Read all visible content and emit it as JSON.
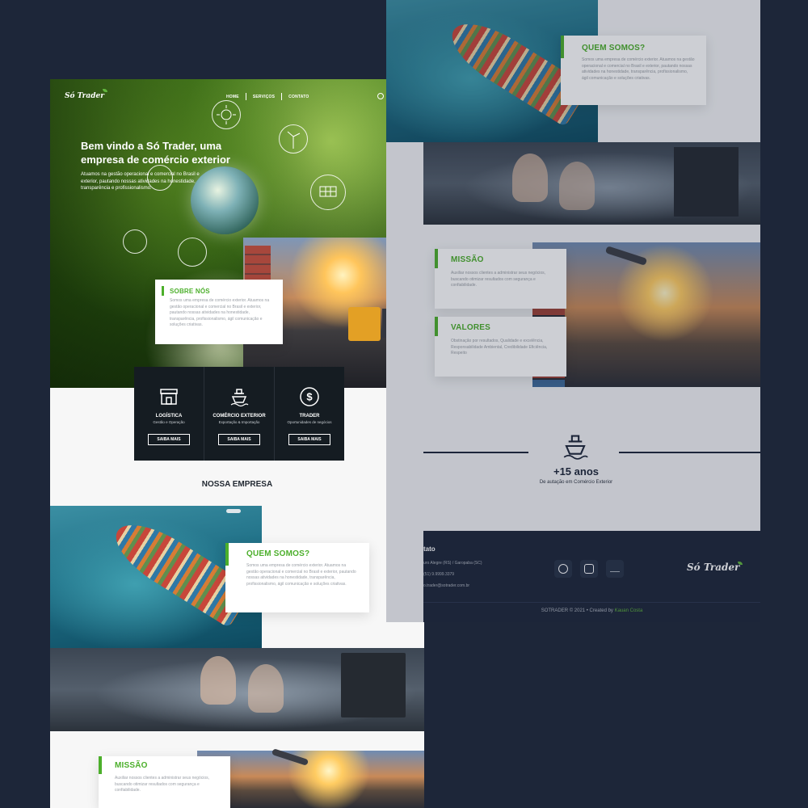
{
  "header": {
    "logo": "Só Trader",
    "nav": [
      "HOME",
      "SERVIÇOS",
      "CONTATO"
    ]
  },
  "hero": {
    "title": "Bem vindo a Só Trader, uma empresa de comércio exterior",
    "text": "Atuamos na gestão operacional e comercial no Brasil e exterior, pautando nossas atividades na honestidade, transparência e profissionalismo."
  },
  "sobre": {
    "title": "SOBRE NÓS",
    "text": "Somos uma empresa de comércio exterior. Atuamos na gestão operacional e comercial no Brasil e exterior, pautando nossas atividades na honestidade, transparência, profissionalismo, ágil comunicação e soluções criativas."
  },
  "services": [
    {
      "icon": "store-icon",
      "title": "LOGÍSTICA",
      "sub": "Gestão e Operação",
      "button": "SAIBA MAIS"
    },
    {
      "icon": "ship-icon",
      "title": "COMÉRCIO EXTERIOR",
      "sub": "Exportação & Importação",
      "button": "SAIBA MAIS"
    },
    {
      "icon": "dollar-icon",
      "title": "TRADER",
      "sub": "Oportunidades de negócios",
      "button": "SAIBA MAIS"
    }
  ],
  "empresa": {
    "title": "NOSSA EMPRESA",
    "quem_title": "QUEM SOMOS?",
    "quem_text": "Somos uma empresa de comércio exterior. Atuamos na gestão operacional e comercial no Brasil e exterior, pautando nossas atividades na honestidade, transparência, profissionalismo, ágil comunicação e soluções criativas.",
    "missao_title": "MISSÃO",
    "missao_text": "Auxiliar nossos clientes a administrar seus negócios, buscando otimizar resultados com segurança e confiabilidade.",
    "valores_title": "VALORES",
    "valores_text": "Obstinação por resultados, Qualidade e excelência, Responsabilidade Ambiental, Credibilidade Eficiência, Respeito"
  },
  "stats": {
    "years": "+15 anos",
    "years_sub": "De autação em Comércio Exterior"
  },
  "footer": {
    "title": "tato",
    "address": "uro Alegre (RS) / Garopaba (SC)",
    "phone": "(51) 9.9999.3379",
    "email": "o.trader@sotrader.com.br",
    "logo": "Só Trader",
    "copyright_prefix": "SOTRADER © 2021 • Created by",
    "copyright_author": "Kauan Costa"
  },
  "colors": {
    "background": "#1d2639",
    "accent_green": "#4caf2b",
    "services_bg": "#151c22"
  }
}
